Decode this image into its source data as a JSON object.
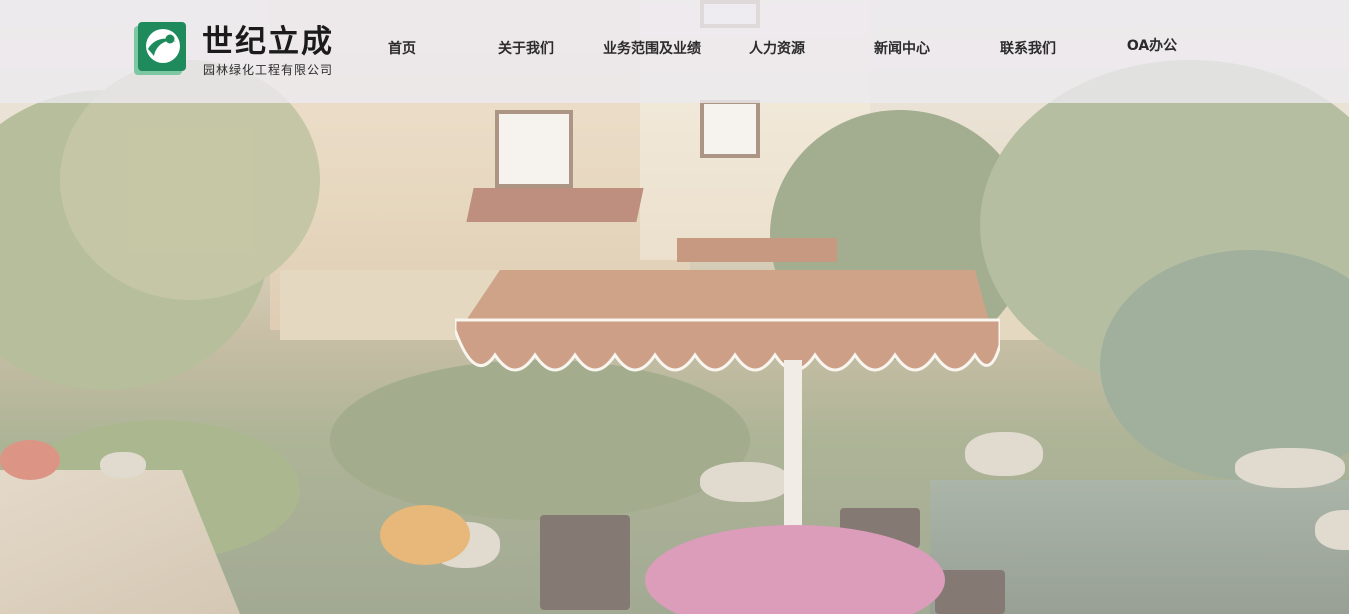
{
  "brand": {
    "name": "世纪立成",
    "subtitle": "园林绿化工程有限公司",
    "logo_icon": "leaf-s-logo-icon",
    "colors": {
      "green": "#1f8a5c",
      "light_green": "#7dc7a2"
    }
  },
  "nav": {
    "items": [
      {
        "label": "首页"
      },
      {
        "label": "关于我们"
      },
      {
        "label": "业务范围及业绩"
      },
      {
        "label": "人力资源"
      },
      {
        "label": "新闻中心"
      },
      {
        "label": "联系我们"
      },
      {
        "label": "OA办公"
      }
    ]
  },
  "hero": {
    "description_icon": "garden-photo"
  }
}
